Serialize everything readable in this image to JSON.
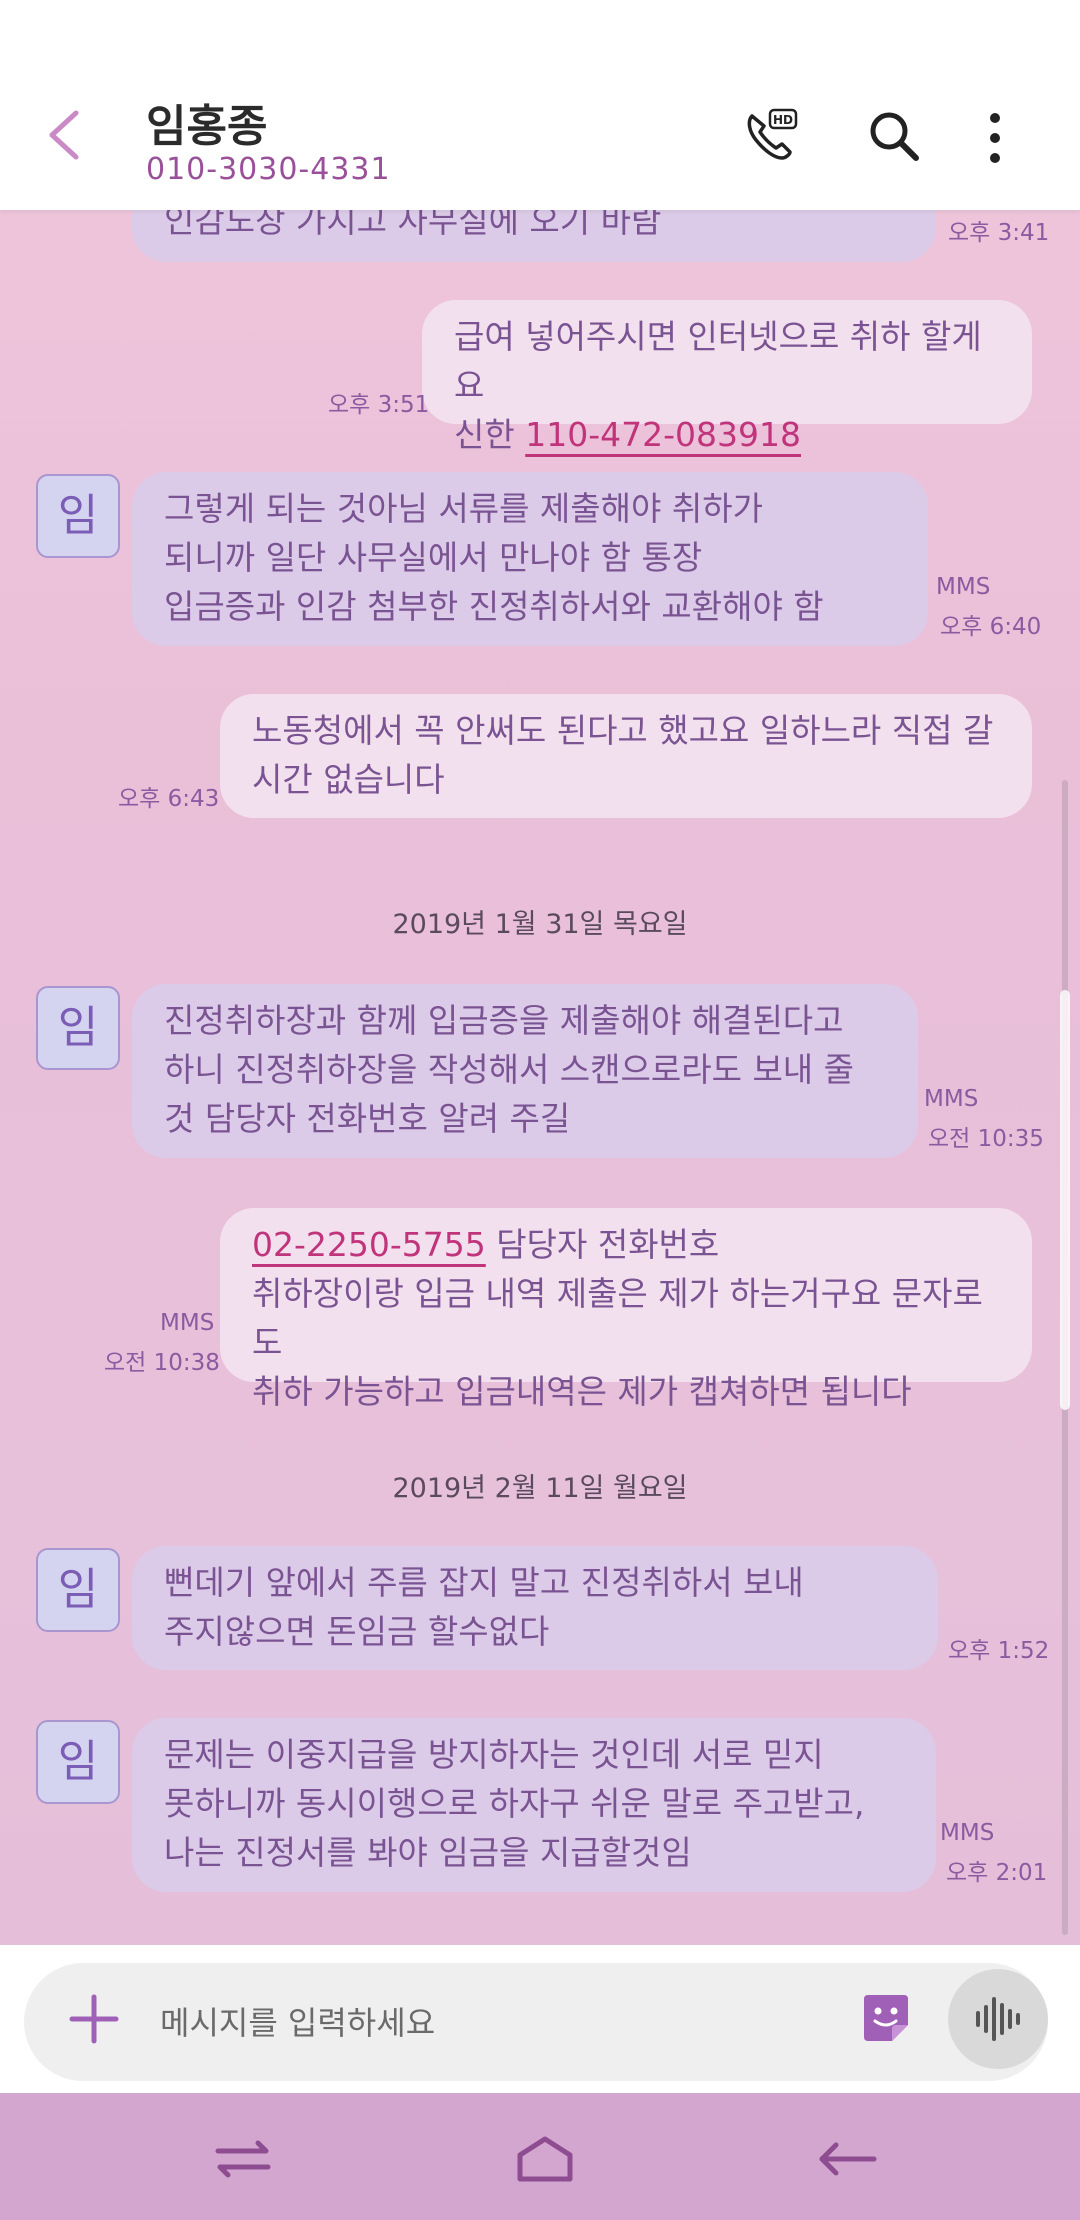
{
  "header": {
    "back_icon": "chevron-left-icon",
    "contact_name": "임홍종",
    "contact_number": "010-3030-4331",
    "actions": [
      "hd-call-icon",
      "search-icon",
      "more-vertical-icon"
    ]
  },
  "messages": {
    "m0": {
      "text": "인감도장 가지고 사무실에 오기 바람",
      "time": "오후 3:41"
    },
    "m1": {
      "line1": "급여 넣어주시면 인터넷으로 취하 할게요",
      "line2_prefix": "신한 ",
      "line2_link": "110-472-083918",
      "time": "오후 3:51"
    },
    "m2": {
      "avatar": "임",
      "line1": "그렇게 되는  것아님   서류를  제출해야  취하가",
      "line2": "되니까  일단  사무실에서  만나야  함     통장",
      "line3": "입금증과  인감  첨부한  진정취하서와  교환해야  함",
      "type": "MMS",
      "time": "오후 6:40"
    },
    "m3": {
      "line1": "노동청에서 꼭 안써도 된다고 했고요 일하느라 직접 갈",
      "line2": "시간 없습니다",
      "time": "오후 6:43"
    },
    "date1": "2019년 1월 31일 목요일",
    "m4": {
      "avatar": "임",
      "line1": "진정취하장과 함께 입금증을  제출해야  해결된다고",
      "line2": "하니 진정취하장을 작성해서   스캔으로라도  보내 줄",
      "line3": "것  담당자 전화번호 알려  주길",
      "type": "MMS",
      "time": "오전 10:35"
    },
    "m5": {
      "line1_link": "02-2250-5755",
      "line1_suffix": " 담당자 전화번호",
      "line2": "취하장이랑 입금 내역 제출은 제가 하는거구요 문자로도",
      "line3": "취하 가능하고 입금내역은 제가 캡쳐하면 됩니다",
      "type": "MMS",
      "time": "오전 10:38"
    },
    "date2": "2019년 2월 11일 월요일",
    "m6": {
      "avatar": "임",
      "line1": "뻔데기 앞에서 주름 잡지 말고  진정취하서 보내",
      "line2": "주지않으면  돈임금  할수없다",
      "time": "오후 1:52"
    },
    "m7": {
      "avatar": "임",
      "line1": "문제는 이중지급을  방지하자는 것인데  서로 믿지",
      "line2": "못하니까       동시이행으로 하자구 쉬운 말로 주고받고,",
      "line3": "나는 진정서를  봐야 임금을 지급할것임",
      "type": "MMS",
      "time": "오후 2:01"
    }
  },
  "composer": {
    "placeholder": "메시지를 입력하세요",
    "add_icon": "plus-icon",
    "sticker_icon": "sticker-icon",
    "voice_icon": "voice-record-icon"
  },
  "navbar": [
    "recent-apps-icon",
    "home-icon",
    "back-icon"
  ],
  "colors": {
    "incoming_bubble": "#dccbe8",
    "outgoing_bubble": "#f3e0ee",
    "text": "#7a5392",
    "link": "#c0347b",
    "navbar": "#d2a6ce"
  }
}
